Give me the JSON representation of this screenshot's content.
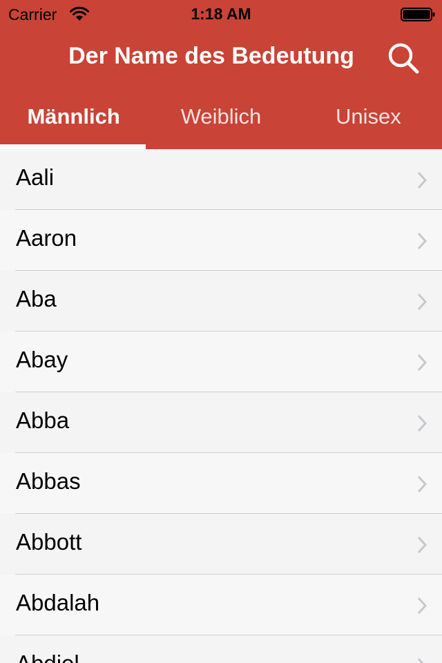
{
  "status_bar": {
    "carrier": "Carrier",
    "time": "1:18 AM"
  },
  "nav": {
    "title": "Der Name des Bedeutung",
    "search_icon": "search-icon"
  },
  "tabs": [
    {
      "label": "Männlich",
      "active": true
    },
    {
      "label": "Weiblich",
      "active": false
    },
    {
      "label": "Unisex",
      "active": false
    }
  ],
  "names": [
    "Aali",
    "Aaron",
    "Aba",
    "Abay",
    "Abba",
    "Abbas",
    "Abbott",
    "Abdalah",
    "Abdiel"
  ],
  "colors": {
    "header": "#c94336",
    "list_background": "#f4f4f4",
    "separator": "#cfcfcf",
    "chevron": "#c7c7cc"
  }
}
